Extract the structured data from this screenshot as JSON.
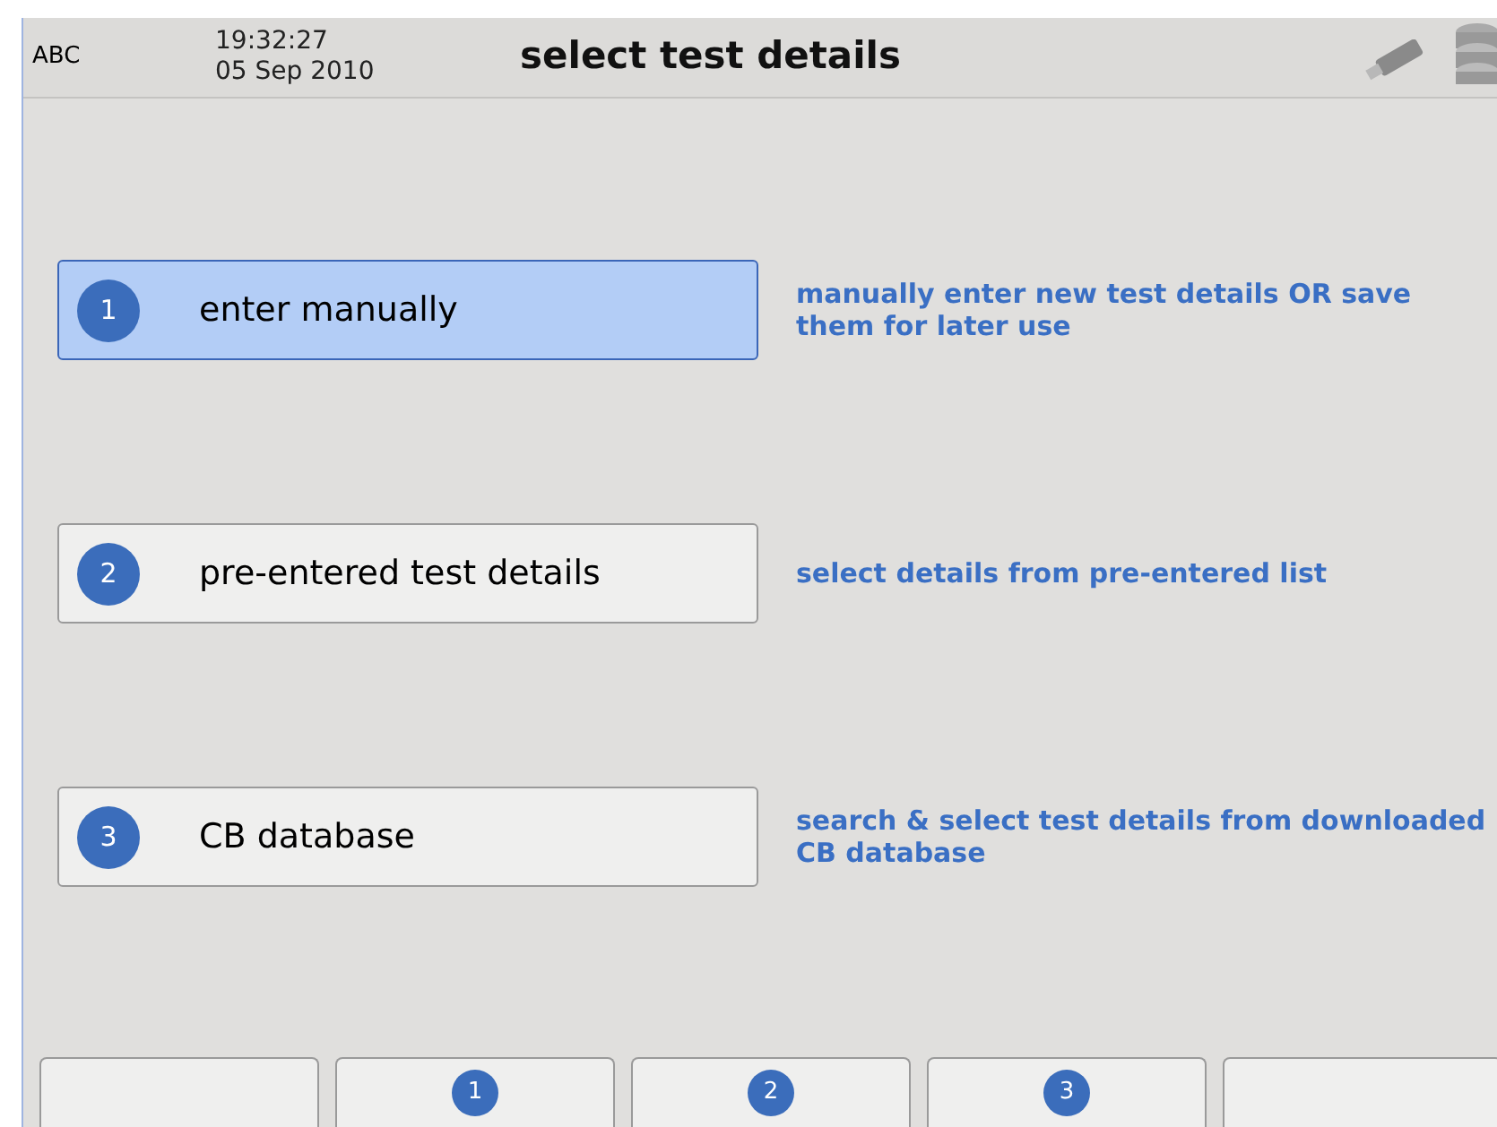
{
  "header": {
    "label": "ABC",
    "time": "19:32:27",
    "date": "05 Sep 2010",
    "title": "select test details"
  },
  "options": [
    {
      "number": "1",
      "label": "enter manually",
      "description": "manually enter new test details OR save them for later use",
      "selected": true
    },
    {
      "number": "2",
      "label": "pre-entered test details",
      "description": "select details from pre-entered list",
      "selected": false
    },
    {
      "number": "3",
      "label": "CB database",
      "description": "search & select test details from downloaded CB database",
      "selected": false
    }
  ],
  "softkeys": [
    {
      "kind": "blank"
    },
    {
      "kind": "number",
      "label": "1"
    },
    {
      "kind": "number",
      "label": "2"
    },
    {
      "kind": "number",
      "label": "3"
    },
    {
      "kind": "blank"
    }
  ]
}
